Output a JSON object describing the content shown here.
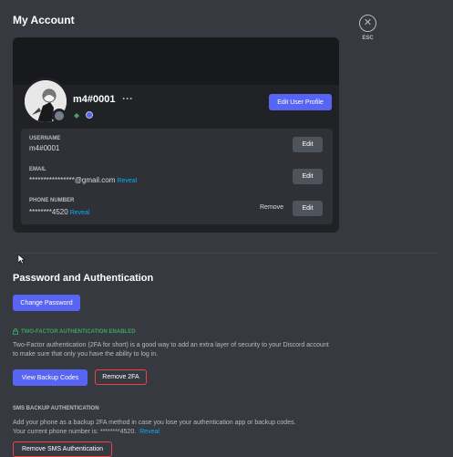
{
  "page_title": "My Account",
  "close": {
    "label": "ESC",
    "glyph": "✕"
  },
  "profile": {
    "display_name": "m4#0001",
    "more_glyph": "···",
    "edit_profile_label": "Edit User Profile"
  },
  "fields": {
    "username": {
      "label": "USERNAME",
      "value": "m4#0001",
      "edit_label": "Edit"
    },
    "email": {
      "label": "EMAIL",
      "value": "****************@gmail.com",
      "reveal_label": "Reveal",
      "edit_label": "Edit"
    },
    "phone": {
      "label": "PHONE NUMBER",
      "value": "********4520",
      "reveal_label": "Reveal",
      "remove_label": "Remove",
      "edit_label": "Edit"
    }
  },
  "password_section": {
    "title": "Password and Authentication",
    "change_password_label": "Change Password",
    "tfa_enabled_label": "TWO-FACTOR AUTHENTICATION ENABLED",
    "tfa_description_line1": "Two-Factor authentication (2FA for short) is a good way to add an extra layer of security to your Discord account",
    "tfa_description_line2": "to make sure that only you have the ability to log in.",
    "view_backup_label": "View Backup Codes",
    "remove_2fa_label": "Remove 2FA",
    "sms_header": "SMS BACKUP AUTHENTICATION",
    "sms_description_line1": "Add your phone as a backup 2FA method in case you lose your authentication app or backup codes.",
    "sms_description_line2": "Your current phone number is: ********4520.",
    "sms_reveal_label": "Reveal",
    "remove_sms_label": "Remove SMS Authentication"
  },
  "colors": {
    "background": "#36393f",
    "card": "#202225",
    "blurple": "#5865f2",
    "danger": "#ed4245",
    "success": "#3ba55c",
    "link": "#00aff4"
  },
  "icons": [
    "close-icon",
    "more-icon",
    "hypesquad-badge-icon",
    "nitro-badge-icon",
    "lock-icon",
    "cursor-icon"
  ]
}
